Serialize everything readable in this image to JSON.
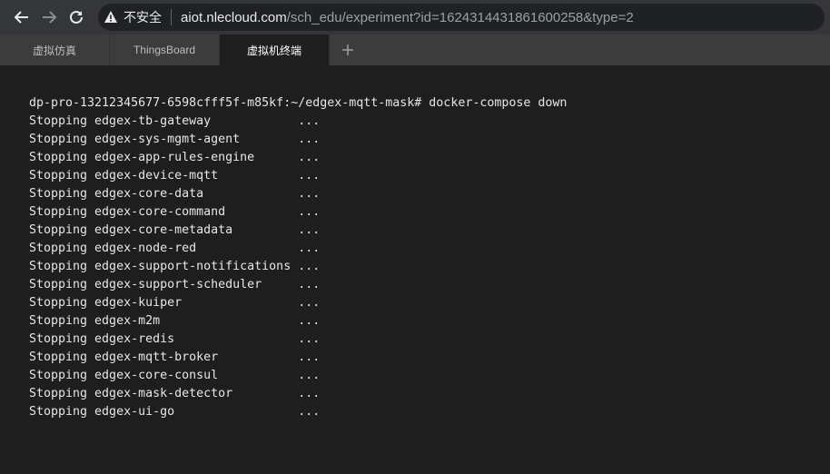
{
  "browser": {
    "security_label": "不安全",
    "url_host": "aiot.nlecloud.com",
    "url_path": "/sch_edu/experiment?id=1624314431861600258&type=2"
  },
  "tabs": [
    {
      "label": "虚拟仿真"
    },
    {
      "label": "ThingsBoard"
    },
    {
      "label": "虚拟机终端"
    }
  ],
  "terminal": {
    "lines": [
      "dp-pro-13212345677-6598cfff5f-m85kf:~/edgex-mqtt-mask# docker-compose down",
      "Stopping edgex-tb-gateway            ...",
      "Stopping edgex-sys-mgmt-agent        ...",
      "Stopping edgex-app-rules-engine      ...",
      "Stopping edgex-device-mqtt           ...",
      "Stopping edgex-core-data             ...",
      "Stopping edgex-core-command          ...",
      "Stopping edgex-core-metadata         ...",
      "Stopping edgex-node-red              ...",
      "Stopping edgex-support-notifications ...",
      "Stopping edgex-support-scheduler     ...",
      "Stopping edgex-kuiper                ...",
      "Stopping edgex-m2m                   ...",
      "Stopping edgex-redis                 ...",
      "Stopping edgex-mqtt-broker           ...",
      "Stopping edgex-core-consul           ...",
      "Stopping edgex-mask-detector         ...",
      "Stopping edgex-ui-go                 ..."
    ]
  }
}
